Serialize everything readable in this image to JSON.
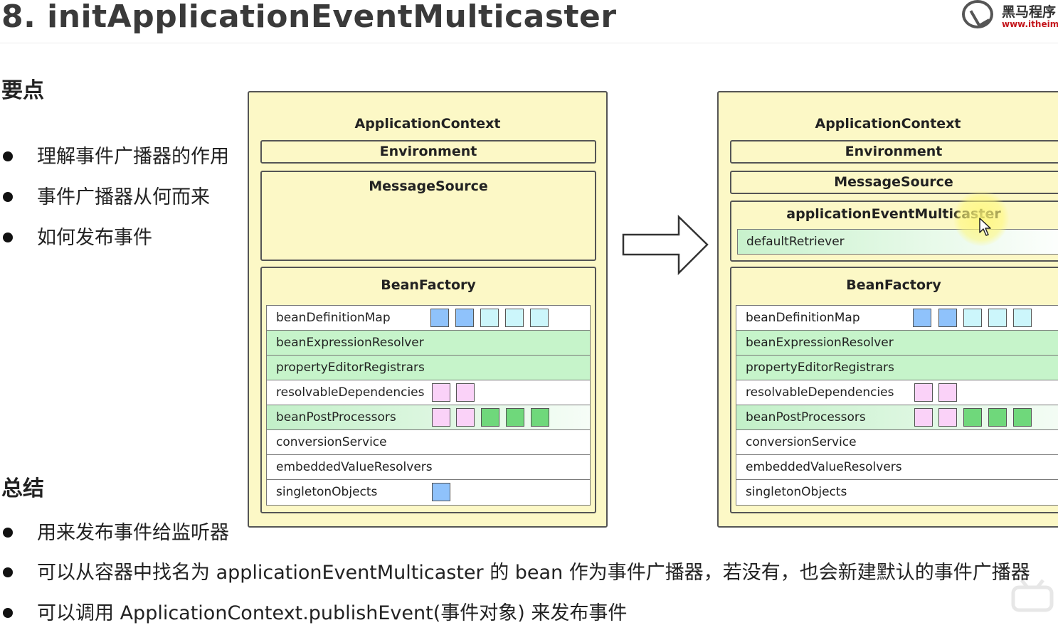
{
  "title": "8. initApplicationEventMulticaster",
  "logo": {
    "name": "黑马程序",
    "url": "www.itheima"
  },
  "key_points": {
    "heading": "要点",
    "items": [
      "理解事件广播器的作用",
      "事件广播器从何而来",
      "如何发布事件"
    ]
  },
  "summary": {
    "heading": "总结",
    "items": [
      "用来发布事件给监听器",
      "可以从容器中找名为 applicationEventMulticaster 的 bean 作为事件广播器，若没有，也会新建默认的事件广播器",
      "可以调用 ApplicationContext.publishEvent(事件对象) 来发布事件"
    ]
  },
  "before": {
    "context_label": "ApplicationContext",
    "environment_label": "Environment",
    "message_source_label": "MessageSource",
    "bean_factory_label": "BeanFactory",
    "rows": [
      "beanDefinitionMap",
      "beanExpressionResolver",
      "propertyEditorRegistrars",
      "resolvableDependencies",
      "beanPostProcessors",
      "conversionService",
      "embeddedValueResolvers",
      "singletonObjects"
    ]
  },
  "after": {
    "context_label": "ApplicationContext",
    "environment_label": "Environment",
    "message_source_label": "MessageSource",
    "multicaster_label": "applicationEventMulticaster",
    "retriever_label": "defaultRetriever",
    "bean_factory_label": "BeanFactory",
    "rows": [
      "beanDefinitionMap",
      "beanExpressionResolver",
      "propertyEditorRegistrars",
      "resolvableDependencies",
      "beanPostProcessors",
      "conversionService",
      "embeddedValueResolvers",
      "singletonObjects"
    ]
  },
  "colors": {
    "context_fill": "#fcf8c6",
    "row_green": "#c6f4ca",
    "square_blue": "#8fc2fb",
    "square_cyan": "#ccf6fb",
    "square_pink": "#fad2f8",
    "square_green": "#6fd87b"
  },
  "icons": [
    "itheima-logo-icon",
    "right-arrow-icon",
    "mouse-cursor-icon",
    "bilibili-watermark-icon"
  ]
}
